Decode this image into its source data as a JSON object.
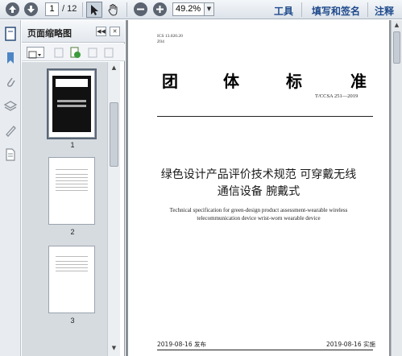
{
  "toolbar": {
    "page_current": "1",
    "page_total": "/ 12",
    "zoom": "49.2%",
    "menu_tools": "工具",
    "menu_sign": "填写和签名",
    "menu_comment": "注释"
  },
  "sidebar": {
    "title": "页面缩略图",
    "thumbnails": [
      {
        "number": "1"
      },
      {
        "number": "2"
      },
      {
        "number": "3"
      }
    ]
  },
  "document": {
    "ics_line1": "ICS 13.020.20",
    "ics_line2": "Z04",
    "heading_chars": [
      "团",
      "体",
      "标",
      "准"
    ],
    "standard_number": "T/CCSA 251—2019",
    "title_cn_line1": "绿色设计产品评价技术规范 可穿戴无线",
    "title_cn_line2": "通信设备 腕戴式",
    "title_en_line1": "Technical specification for green-design product assessment-wearable wireless",
    "title_en_line2": "telecommunication device wrist-worn wearable device",
    "publish_date": "2019-08-16 发布",
    "implement_date": "2019-08-16 实施"
  }
}
